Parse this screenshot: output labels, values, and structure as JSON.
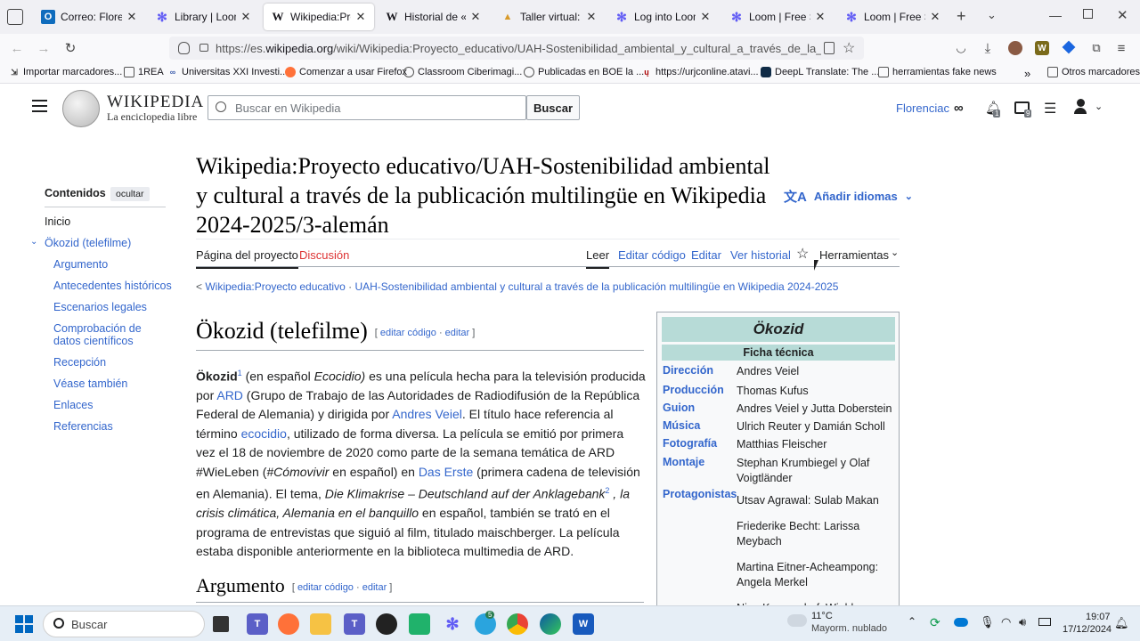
{
  "browser": {
    "tabs": [
      {
        "label": "Correo: Florencia Ceba",
        "icon": "outlook-icon"
      },
      {
        "label": "Library | Loom",
        "icon": "loom-icon"
      },
      {
        "label": "Wikipedia:Proyecto educativo",
        "icon": "wikipedia-icon",
        "active": true
      },
      {
        "label": "Historial de «Wikipedia",
        "icon": "wikipedia-icon"
      },
      {
        "label": "Taller virtual: Cómo",
        "icon": "taller-icon"
      },
      {
        "label": "Log into Loom | Loom",
        "icon": "loom-icon"
      },
      {
        "label": "Loom | Free Screen Recorder",
        "icon": "loom-icon"
      },
      {
        "label": "Loom | Free Screen Recorder",
        "icon": "loom-icon"
      }
    ],
    "url_prefix": "https://es.",
    "url_domain": "wikipedia.org",
    "url_rest": "/wiki/Wikipedia:Proyecto_educativo/UAH-Sostenibilidad_ambiental_y_cultural_a_través_de_la_publicación_mu",
    "bookmarks": [
      "Importar marcadores...",
      "1REA",
      "Universitas XXI Investi...",
      "Comenzar a usar Firefox",
      "Classroom Ciberimagi...",
      "Publicadas en BOE la ...",
      "https://urjconline.atavi...",
      "DeepL Translate: The ...",
      "herramientas fake news"
    ],
    "other_bookmarks": "Otros marcadores"
  },
  "wiki": {
    "logo_title": "Wikipedia",
    "logo_subtitle": "La enciclopedia libre",
    "search_placeholder": "Buscar en Wikipedia",
    "search_button": "Buscar",
    "username": "Florenciac",
    "notif_count": "1",
    "msg_count": "9",
    "title": "Wikipedia:Proyecto educativo/UAH-Sostenibilidad ambiental y cultural a través de la publicación multilingüe en Wikipedia 2024-2025/3-alemán",
    "add_languages": "Añadir idiomas",
    "page_tabs": {
      "project": "Página del proyecto",
      "discussion": "Discusión",
      "read": "Leer",
      "edit_source": "Editar código",
      "edit": "Editar",
      "history": "Ver historial",
      "tools": "Herramientas"
    },
    "breadcrumb_1": "Wikipedia:Proyecto educativo",
    "breadcrumb_2": "UAH-Sostenibilidad ambiental y cultural a través de la publicación multilingüe en Wikipedia 2024-2025",
    "toc": {
      "heading": "Contenidos",
      "hide": "ocultar",
      "items": [
        "Inicio",
        "Ökozid (telefilme)",
        "Argumento",
        "Antecedentes históricos",
        "Escenarios legales",
        "Comprobación de datos científicos",
        "Recepción",
        "Véase también",
        "Enlaces",
        "Referencias"
      ]
    },
    "section1": {
      "title": "Ökozid (telefilme)",
      "edit_source": "editar código",
      "edit": "editar"
    },
    "section2": {
      "title": "Argumento",
      "edit_source": "editar código",
      "edit": "editar"
    },
    "para": {
      "b1": "Ökozid",
      "s1": "1",
      "t1": " (en español ",
      "i1": "Ecocidio)",
      "t2": " es una película hecha para la televisión producida por ",
      "l1": "ARD",
      "t3": " (Grupo de Trabajo de las Autoridades de Radiodifusión de la República Federal de Alemania) y dirigida por ",
      "l2": "Andres Veiel",
      "t4": ". El título hace referencia al término ",
      "l3": "ecocidio",
      "t5": ", utilizado de forma diversa. La película se emitió por primera vez el 18 de noviembre de 2020 como parte de la semana temática de ARD #WieLeben (",
      "i2": "#Cómovivir",
      "t6": " en español) en ",
      "l4": "Das Erste",
      "t7": " (primera cadena de televisión en Alemania). El tema, ",
      "i3": "Die Klimakrise – Deutschland auf der Anklagebank",
      "s2": "2",
      "i4": " , la crisis climática, Alemania en el banquillo",
      "t8": " en español, también se trató en el programa de entrevistas que siguió al film, titulado maischberger. La película estaba disponible anteriormente en la biblioteca multimedia de ARD."
    },
    "infobox": {
      "title": "Ökozid",
      "header": "Ficha técnica",
      "rows": [
        {
          "label": "Dirección",
          "value": "Andres Veiel"
        },
        {
          "label": "Producción",
          "value": "Thomas Kufus"
        },
        {
          "label": "Guion",
          "value": "Andres Veiel y Jutta Doberstein"
        },
        {
          "label": "Música",
          "value": "Ulrich Reuter y Damián Scholl"
        },
        {
          "label": "Fotografía",
          "value": "Matthias Fleischer"
        },
        {
          "label": "Montaje",
          "value": "Stephan Krumbiegel y Olaf Voigtländer"
        },
        {
          "label": "Protagonistas",
          "value": "Utsav Agrawal: Sulab Makan"
        }
      ],
      "cast_extra": [
        "Friederike Becht: Larissa Meybach",
        "Martina Eitner-Acheampong: Angela Merkel",
        "Nina Kunzendorf: Wiebke"
      ]
    }
  },
  "taskbar": {
    "search_placeholder": "Buscar",
    "weather_temp": "11°C",
    "weather_desc": "Mayorm. nublado",
    "time": "19:07",
    "date": "17/12/2024",
    "telegram_badge": "5"
  },
  "colors": {
    "link": "#3366cc",
    "redlink": "#dd3333",
    "infobox_header": "#b7dbd7"
  }
}
